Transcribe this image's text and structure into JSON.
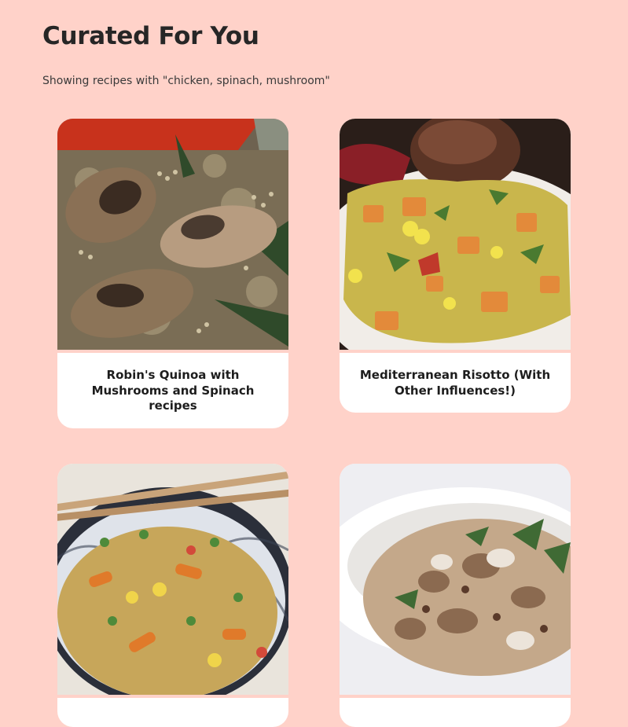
{
  "header": {
    "title": "Curated For You",
    "subtitle": "Showing recipes with \"chicken, spinach, mushroom\""
  },
  "recipes": [
    {
      "title": "Robin's Quinoa with Mushrooms and Spinach recipes",
      "image_icon": "quinoa-mushroom-photo"
    },
    {
      "title": "Mediterranean Risotto (With Other Influences!)",
      "image_icon": "risotto-photo"
    },
    {
      "title": "",
      "image_icon": "fried-rice-photo"
    },
    {
      "title": "",
      "image_icon": "stew-photo"
    }
  ],
  "colors": {
    "background": "#ffd2c9",
    "card": "#ffffff",
    "text": "#262626"
  }
}
